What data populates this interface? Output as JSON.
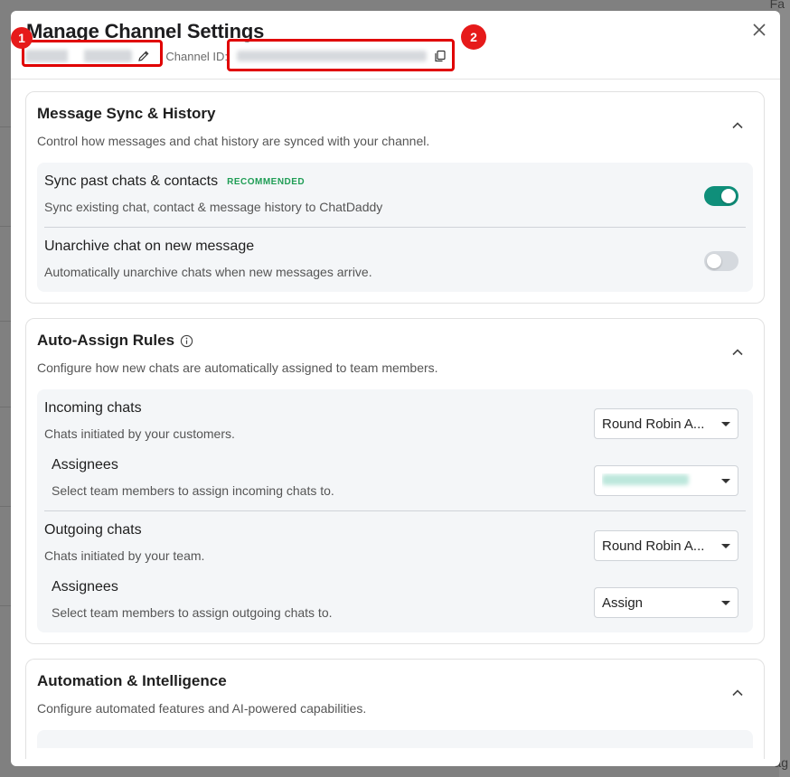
{
  "background": {
    "top_right_text": "Fa",
    "bottom_right_text": "ag"
  },
  "modal": {
    "title": "Manage Channel Settings",
    "separator": "|",
    "channel_id_label": "Channel ID:",
    "annotations": [
      "1",
      "2"
    ]
  },
  "sections": {
    "sync": {
      "title": "Message Sync & History",
      "description": "Control how messages and chat history are synced with your channel.",
      "rows": [
        {
          "title": "Sync past chats & contacts",
          "badge": "RECOMMENDED",
          "description": "Sync existing chat, contact & message history to ChatDaddy",
          "enabled": true
        },
        {
          "title": "Unarchive chat on new message",
          "description": "Automatically unarchive chats when new messages arrive.",
          "enabled": false
        }
      ]
    },
    "assign": {
      "title": "Auto-Assign Rules",
      "description": "Configure how new chats are automatically assigned to team members.",
      "incoming": {
        "title": "Incoming chats",
        "description": "Chats initiated by your customers.",
        "select": "Round Robin A...",
        "assignees_title": "Assignees",
        "assignees_description": "Select team members to assign incoming chats to."
      },
      "outgoing": {
        "title": "Outgoing chats",
        "description": "Chats initiated by your team.",
        "select": "Round Robin A...",
        "assignees_title": "Assignees",
        "assignees_description": "Select team members to assign outgoing chats to.",
        "assignees_select": "Assign"
      }
    },
    "automation": {
      "title": "Automation & Intelligence",
      "description": "Configure automated features and AI-powered capabilities."
    }
  },
  "colors": {
    "toggle_on": "#0f8f7a",
    "recommended": "#1f9d55",
    "annotation": "#e00000"
  }
}
